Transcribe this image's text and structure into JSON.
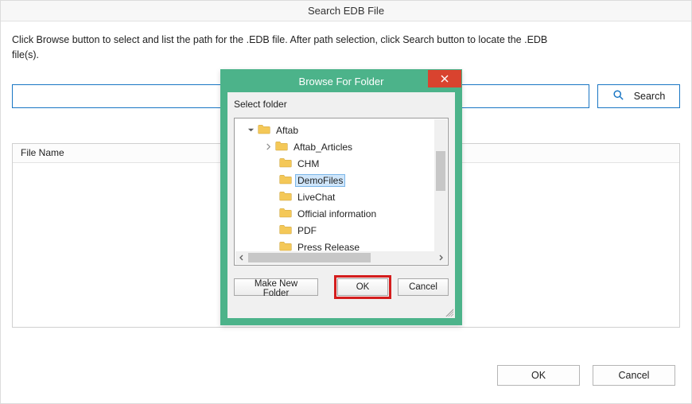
{
  "window": {
    "title": "Search EDB File",
    "instruction": "Click Browse button to select and list the path for the .EDB file. After path selection, click Search button to locate the .EDB file(s).",
    "search_label": "Search",
    "table_header": "File Name",
    "ok_label": "OK",
    "cancel_label": "Cancel"
  },
  "modal": {
    "title": "Browse For Folder",
    "select_label": "Select folder",
    "make_folder_label": "Make New Folder",
    "ok_label": "OK",
    "cancel_label": "Cancel",
    "tree": {
      "root": "Aftab",
      "items": [
        {
          "label": "Aftab_Articles",
          "expandable": true
        },
        {
          "label": "CHM",
          "expandable": false
        },
        {
          "label": "DemoFiles",
          "expandable": false,
          "selected": true
        },
        {
          "label": "LiveChat",
          "expandable": false
        },
        {
          "label": "Official information",
          "expandable": false
        },
        {
          "label": "PDF",
          "expandable": false
        },
        {
          "label": "Press Release",
          "expandable": false
        }
      ]
    }
  }
}
